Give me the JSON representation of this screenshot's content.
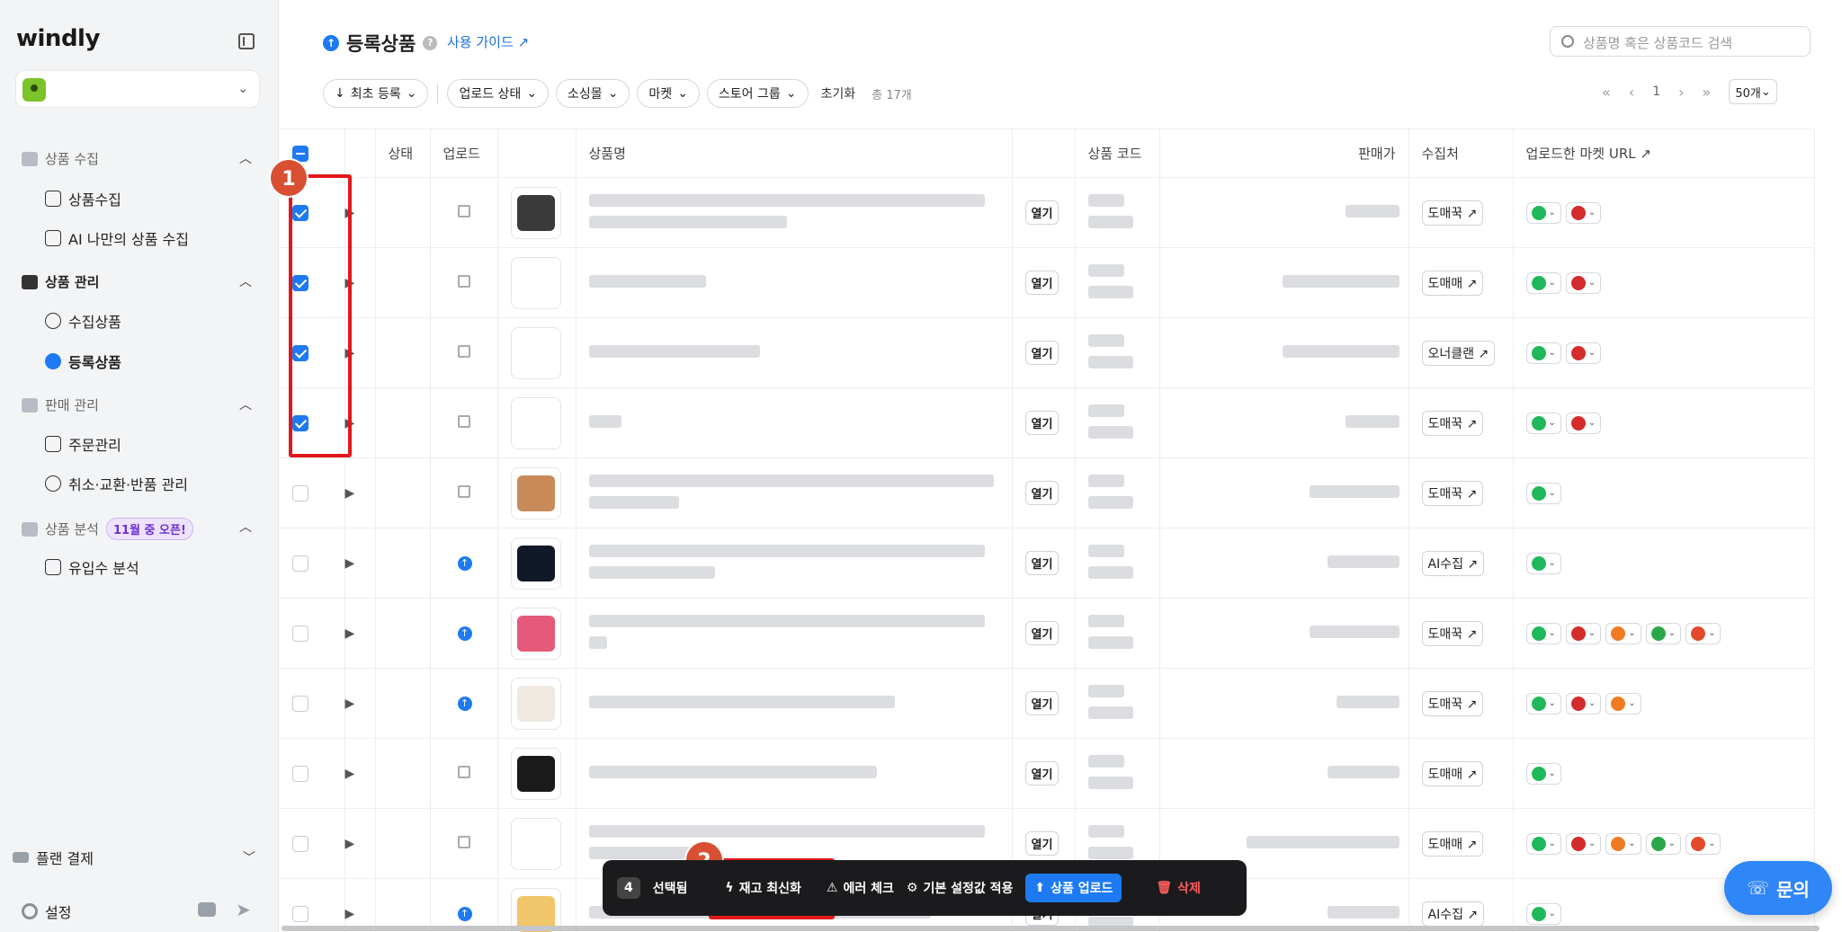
{
  "sidebar": {
    "logo": "windly",
    "sections": [
      {
        "label": "상품 수집",
        "items": [
          "상품수집",
          "AI 나만의 상품 수집"
        ]
      },
      {
        "label": "상품 관리",
        "items": [
          "수집상품",
          "등록상품"
        ]
      },
      {
        "label": "판매 관리",
        "items": [
          "주문관리",
          "취소·교환·반품 관리"
        ]
      },
      {
        "label": "상품 분석",
        "badge": "11월 중 오픈!",
        "items": [
          "유입수 분석"
        ]
      }
    ],
    "plan": "플랜 결제",
    "settings": "설정"
  },
  "header": {
    "title": "등록상품",
    "guide": "사용 가이드",
    "search_placeholder": "상품명 혹은 상품코드 검색"
  },
  "filters": {
    "sort": "최초 등록",
    "upload_status": "업로드 상태",
    "sourcing": "소싱몰",
    "market": "마켓",
    "store_group": "스토어 그룹",
    "reset": "초기화",
    "total": "총 17개"
  },
  "pager": {
    "first": "«",
    "prev": "‹",
    "page": "1",
    "next": "›",
    "last": "»",
    "per_page": "50개"
  },
  "table": {
    "headers": [
      "상태",
      "업로드",
      "상품명",
      "상품 코드",
      "판매가",
      "수집처",
      "업로드한 마켓 URL"
    ],
    "open_label": "열기",
    "rows": [
      {
        "checked": true,
        "upload": "save",
        "source": "도매꾹"
      },
      {
        "checked": true,
        "upload": "save",
        "source": "도매매"
      },
      {
        "checked": true,
        "upload": "save",
        "source": "오너클랜"
      },
      {
        "checked": true,
        "upload": "save",
        "source": "도매꾹"
      },
      {
        "checked": false,
        "upload": "save",
        "source": "도매꾹"
      },
      {
        "checked": false,
        "upload": "uploaded",
        "source": "AI수집"
      },
      {
        "checked": false,
        "upload": "uploaded",
        "source": "도매꾹"
      },
      {
        "checked": false,
        "upload": "uploaded",
        "source": "도매꾹"
      },
      {
        "checked": false,
        "upload": "save",
        "source": "도매매"
      },
      {
        "checked": false,
        "upload": "save",
        "source": "도매매"
      },
      {
        "checked": false,
        "upload": "uploaded",
        "source": "AI수집"
      }
    ]
  },
  "annotations": {
    "step1": "1",
    "step2": "2"
  },
  "action_bar": {
    "count": "4",
    "selected": "선택됨",
    "refresh": "재고 최신화",
    "error_check": "에러 체크",
    "apply_defaults": "기본 설정값 적용",
    "upload": "상품 업로드",
    "delete": "삭제"
  },
  "help": {
    "label": "문의"
  },
  "colors": {
    "accent": "#1d7af3",
    "highlight": "#e1181b",
    "step": "#d94f31"
  }
}
